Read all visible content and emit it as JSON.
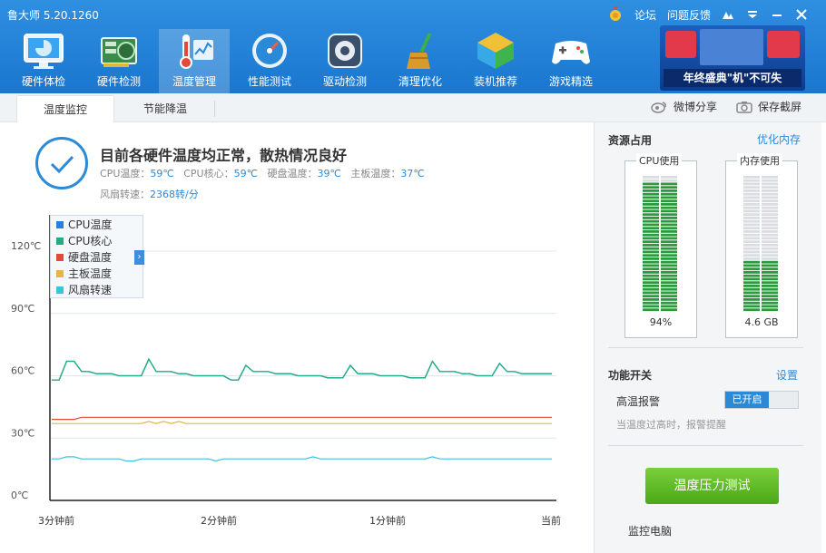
{
  "app": {
    "title": "鲁大师 5.20.1260"
  },
  "window_controls": {
    "forum": "论坛",
    "feedback": "问题反馈"
  },
  "nav": [
    {
      "label": "硬件体检",
      "icon": "monitor-icon"
    },
    {
      "label": "硬件检测",
      "icon": "graphics-card-icon"
    },
    {
      "label": "温度管理",
      "icon": "thermometer-icon",
      "active": true
    },
    {
      "label": "性能测试",
      "icon": "speedometer-icon"
    },
    {
      "label": "驱动检测",
      "icon": "driver-gear-icon"
    },
    {
      "label": "清理优化",
      "icon": "broom-icon"
    },
    {
      "label": "装机推荐",
      "icon": "cube-icon"
    },
    {
      "label": "游戏精选",
      "icon": "gamepad-icon"
    }
  ],
  "banner": {
    "text": "年终盛典\"机\"不可失"
  },
  "subtabs": [
    {
      "label": "温度监控",
      "active": true
    },
    {
      "label": "节能降温",
      "active": false
    }
  ],
  "share": {
    "weibo": "微博分享",
    "screenshot": "保存截屏"
  },
  "status": {
    "title": "目前各硬件温度均正常，散热情况良好",
    "cpu_temp_label": "CPU温度：",
    "cpu_temp": "59℃",
    "cpu_core_label": "CPU核心：",
    "cpu_core": "59℃",
    "disk_label": "硬盘温度：",
    "disk": "39℃",
    "board_label": "主板温度：",
    "board": "37℃",
    "fan_label": "风扇转速：",
    "fan": "2368转/分"
  },
  "chart_data": {
    "type": "line",
    "y_ticks": [
      "120℃",
      "90℃",
      "60℃",
      "30℃",
      "0℃"
    ],
    "ylim": [
      0,
      120
    ],
    "x_ticks": [
      "3分钟前",
      "2分钟前",
      "1分钟前",
      "当前"
    ],
    "series": [
      {
        "name": "CPU温度",
        "color": "#2b7fd8",
        "values": [
          58,
          58,
          67,
          67,
          62,
          62,
          61,
          61,
          61,
          60,
          60,
          60,
          60,
          68,
          62,
          62,
          62,
          61,
          61,
          60,
          60,
          60,
          60,
          60,
          58,
          58,
          65,
          62,
          62,
          62,
          61,
          61,
          61,
          60,
          60,
          60,
          60,
          59,
          59,
          59,
          65,
          61,
          61,
          61,
          60,
          60,
          60,
          60,
          59,
          59,
          59,
          67,
          62,
          62,
          62,
          61,
          61,
          60,
          60,
          60,
          66,
          62,
          62,
          61,
          61,
          61,
          61,
          61
        ]
      },
      {
        "name": "CPU核心",
        "color": "#1fae83",
        "values": [
          58,
          58,
          67,
          67,
          62,
          62,
          61,
          61,
          61,
          60,
          60,
          60,
          60,
          68,
          62,
          62,
          62,
          61,
          61,
          60,
          60,
          60,
          60,
          60,
          58,
          58,
          65,
          62,
          62,
          62,
          61,
          61,
          61,
          60,
          60,
          60,
          60,
          59,
          59,
          59,
          65,
          61,
          61,
          61,
          60,
          60,
          60,
          60,
          59,
          59,
          59,
          67,
          62,
          62,
          62,
          61,
          61,
          60,
          60,
          60,
          66,
          62,
          62,
          61,
          61,
          61,
          61,
          61
        ]
      },
      {
        "name": "硬盘温度",
        "color": "#e04a3c",
        "values": [
          39,
          39,
          39,
          39,
          40,
          40,
          40,
          40,
          40,
          40,
          40,
          40,
          40,
          40,
          40,
          40,
          40,
          40,
          40,
          40,
          40,
          40,
          40,
          40,
          40,
          40,
          40,
          40,
          40,
          40,
          40,
          40,
          40,
          40,
          40,
          40,
          40,
          40,
          40,
          40,
          40,
          40,
          40,
          40,
          40,
          40,
          40,
          40,
          40,
          40,
          40,
          40,
          40,
          40,
          40,
          40,
          40,
          40,
          40,
          40,
          40,
          40,
          40,
          40,
          40,
          40,
          40,
          40
        ]
      },
      {
        "name": "主板温度",
        "color": "#e9b345",
        "values": [
          37,
          37,
          37,
          37,
          37,
          37,
          37,
          37,
          37,
          37,
          37,
          37,
          37,
          38,
          37,
          38,
          37,
          38,
          37,
          37,
          37,
          37,
          37,
          37,
          37,
          37,
          37,
          37,
          37,
          37,
          37,
          37,
          37,
          37,
          37,
          37,
          37,
          37,
          37,
          37,
          37,
          37,
          37,
          37,
          37,
          37,
          37,
          37,
          37,
          37,
          37,
          37,
          37,
          37,
          37,
          37,
          37,
          37,
          37,
          37,
          37,
          37,
          37,
          37,
          37,
          37,
          37,
          37
        ]
      },
      {
        "name": "风扇转速",
        "color": "#3cc4dd",
        "values": [
          20,
          20,
          21,
          21,
          20,
          20,
          20,
          20,
          20,
          20,
          19,
          19,
          20,
          20,
          20,
          20,
          20,
          20,
          20,
          20,
          20,
          20,
          19,
          20,
          20,
          20,
          20,
          20,
          20,
          20,
          20,
          20,
          20,
          20,
          20,
          21,
          20,
          20,
          20,
          20,
          20,
          20,
          20,
          20,
          20,
          20,
          20,
          20,
          20,
          20,
          20,
          21,
          20,
          20,
          20,
          20,
          20,
          20,
          20,
          20,
          20,
          20,
          20,
          20,
          20,
          20,
          20,
          20
        ]
      }
    ]
  },
  "resources": {
    "title": "资源占用",
    "optimize": "优化内存",
    "cpu_label": "CPU使用",
    "cpu_value": "94%",
    "cpu_fraction": 0.94,
    "mem_label": "内存使用",
    "mem_value": "4.6 GB",
    "mem_fraction": 0.38
  },
  "functions": {
    "title": "功能开关",
    "settings": "设置",
    "alarm_label": "高温报警",
    "alarm_state": "已开启",
    "alarm_desc": "当温度过高时，报警提醒"
  },
  "stress_test": "温度压力测试",
  "footer": {
    "monitor": "监控电脑"
  }
}
